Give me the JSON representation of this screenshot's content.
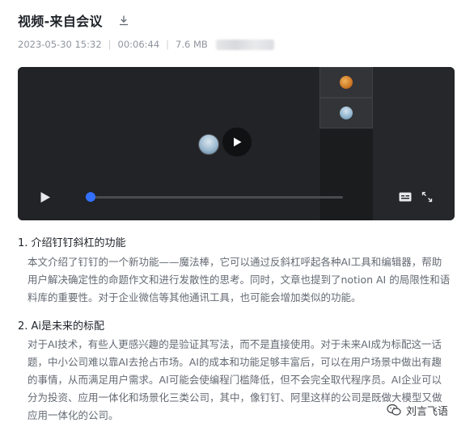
{
  "header": {
    "title": "视频-来自会议",
    "download_icon": "download-icon"
  },
  "meta": {
    "datetime": "2023-05-30 15:32",
    "duration": "00:06:44",
    "size": "7.6 MB"
  },
  "player": {
    "play_icon": "play-icon",
    "subtitle_icon": "subtitles-icon",
    "fullscreen_icon": "fullscreen-icon",
    "progress_fraction": 0.02,
    "accent_color": "#3370ff"
  },
  "sections": [
    {
      "heading": "1. 介绍钉钉斜杠的功能",
      "body": "本文介绍了钉钉的一个新功能——魔法棒，它可以通过反斜杠呼起各种AI工具和编辑器，帮助用户解决确定性的命题作文和进行发散性的思考。同时，文章也提到了notion AI 的局限性和语料库的重要性。对于企业微信等其他通讯工具，也可能会增加类似的功能。"
    },
    {
      "heading": "2. Ai是未来的标配",
      "body": "对于AI技术，有些人更感兴趣的是验证其写法，而不是直接使用。对于未来AI成为标配这一话题，中小公司难以靠AI去抢占市场。AI的成本和功能足够丰富后，可以在用户场景中做出有趣的事情，从而满足用户需求。AI可能会使编程门槛降低，但不会完全取代程序员。AI企业可以分为投资、应用一体化和场景化三类公司，其中，像钉钉、阿里这样的公司是既做大模型又做应用一体化的公司。"
    }
  ],
  "watermark": {
    "text": "刘言飞语",
    "icon": "wechat-icon"
  }
}
